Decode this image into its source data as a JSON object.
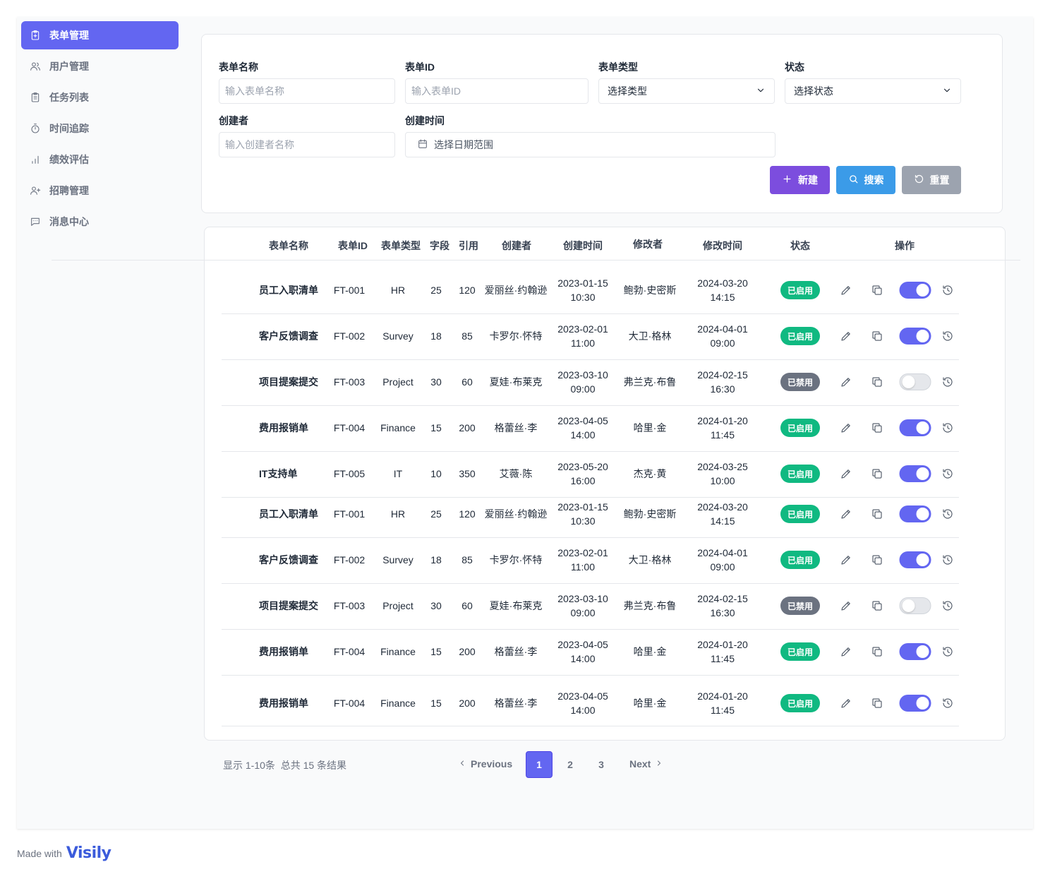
{
  "sidebar": {
    "items": [
      {
        "label": "表单管理",
        "icon": "clipboard-icon",
        "active": true
      },
      {
        "label": "用户管理",
        "icon": "users-icon",
        "active": false
      },
      {
        "label": "任务列表",
        "icon": "clipboard-list-icon",
        "active": false
      },
      {
        "label": "时间追踪",
        "icon": "timer-icon",
        "active": false
      },
      {
        "label": "绩效评估",
        "icon": "bar-chart-icon",
        "active": false
      },
      {
        "label": "招聘管理",
        "icon": "user-plus-icon",
        "active": false
      },
      {
        "label": "消息中心",
        "icon": "message-icon",
        "active": false
      }
    ]
  },
  "filters": {
    "form_name": {
      "label": "表单名称",
      "placeholder": "输入表单名称"
    },
    "form_id": {
      "label": "表单ID",
      "placeholder": "输入表单ID"
    },
    "form_type": {
      "label": "表单类型",
      "value": "选择类型"
    },
    "status": {
      "label": "状态",
      "value": "选择状态"
    },
    "creator": {
      "label": "创建者",
      "placeholder": "输入创建者名称"
    },
    "created_time": {
      "label": "创建时间",
      "value": "选择日期范围"
    }
  },
  "buttons": {
    "new_label": "新建",
    "search_label": "搜索",
    "reset_label": "重置"
  },
  "colors": {
    "primary": "#6366f1",
    "new_button": "#7c4dde",
    "search_button": "#3b9be8",
    "reset_button": "#9ca3af",
    "enabled_badge": "#10b981",
    "disabled_badge": "#6b7280"
  },
  "table": {
    "columns": [
      "表单名称",
      "表单ID",
      "表单类型",
      "字段",
      "引用",
      "创建者",
      "创建时间",
      "修改者",
      "修改时间",
      "状态",
      "操作"
    ],
    "rows": [
      {
        "name": "员工入职清单",
        "id": "FT-001",
        "type": "HR",
        "fields": "25",
        "refs": "120",
        "creator": "爱丽丝·约翰逊",
        "created": "2023-01-15 10:30",
        "modifier": "鲍勃·史密斯",
        "modified": "2024-03-20 14:15",
        "status": "已启用",
        "enabled": true
      },
      {
        "name": "客户反馈调查",
        "id": "FT-002",
        "type": "Survey",
        "fields": "18",
        "refs": "85",
        "creator": "卡罗尔·怀特",
        "created": "2023-02-01 11:00",
        "modifier": "大卫·格林",
        "modified": "2024-04-01 09:00",
        "status": "已启用",
        "enabled": true
      },
      {
        "name": "项目提案提交",
        "id": "FT-003",
        "type": "Project",
        "fields": "30",
        "refs": "60",
        "creator": "夏娃·布莱克",
        "created": "2023-03-10 09:00",
        "modifier": "弗兰克·布鲁",
        "modified": "2024-02-15 16:30",
        "status": "已禁用",
        "enabled": false
      },
      {
        "name": "费用报销单",
        "id": "FT-004",
        "type": "Finance",
        "fields": "15",
        "refs": "200",
        "creator": "格蕾丝·李",
        "created": "2023-04-05 14:00",
        "modifier": "哈里·金",
        "modified": "2024-01-20 11:45",
        "status": "已启用",
        "enabled": true
      },
      {
        "name": "IT支持单",
        "id": "FT-005",
        "type": "IT",
        "fields": "10",
        "refs": "350",
        "creator": "艾薇·陈",
        "created": "2023-05-20 16:00",
        "modifier": "杰克·黄",
        "modified": "2024-03-25 10:00",
        "status": "已启用",
        "enabled": true
      },
      {
        "name": "员工入职清单",
        "id": "FT-001",
        "type": "HR",
        "fields": "25",
        "refs": "120",
        "creator": "爱丽丝·约翰逊",
        "created": "2023-01-15 10:30",
        "modifier": "鲍勃·史密斯",
        "modified": "2024-03-20 14:15",
        "status": "已启用",
        "enabled": true
      },
      {
        "name": "客户反馈调查",
        "id": "FT-002",
        "type": "Survey",
        "fields": "18",
        "refs": "85",
        "creator": "卡罗尔·怀特",
        "created": "2023-02-01 11:00",
        "modifier": "大卫·格林",
        "modified": "2024-04-01 09:00",
        "status": "已启用",
        "enabled": true
      },
      {
        "name": "项目提案提交",
        "id": "FT-003",
        "type": "Project",
        "fields": "30",
        "refs": "60",
        "creator": "夏娃·布莱克",
        "created": "2023-03-10 09:00",
        "modifier": "弗兰克·布鲁",
        "modified": "2024-02-15 16:30",
        "status": "已禁用",
        "enabled": false
      },
      {
        "name": "费用报销单",
        "id": "FT-004",
        "type": "Finance",
        "fields": "15",
        "refs": "200",
        "creator": "格蕾丝·李",
        "created": "2023-04-05 14:00",
        "modifier": "哈里·金",
        "modified": "2024-01-20 11:45",
        "status": "已启用",
        "enabled": true
      },
      {
        "name": "费用报销单",
        "id": "FT-004",
        "type": "Finance",
        "fields": "15",
        "refs": "200",
        "creator": "格蕾丝·李",
        "created": "2023-04-05 14:00",
        "modifier": "哈里·金",
        "modified": "2024-01-20 11:45",
        "status": "已启用",
        "enabled": true
      }
    ]
  },
  "pagination": {
    "summary": "显示 1-10条  总共 15 条结果",
    "previous_label": "Previous",
    "next_label": "Next",
    "pages": [
      "1",
      "2",
      "3"
    ],
    "current_page": "1"
  },
  "footer": {
    "made_with": "Made with",
    "brand": "Visily"
  }
}
